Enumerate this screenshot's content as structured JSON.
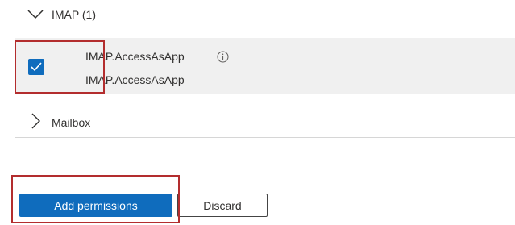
{
  "group": {
    "title": "IMAP (1)",
    "expanded": true,
    "chevron_icon": "chevron-down-icon"
  },
  "permission": {
    "name": "IMAP.AccessAsApp",
    "description": "IMAP.AccessAsApp",
    "checked": true,
    "info_icon": "info-icon"
  },
  "mailbox_group": {
    "title": "Mailbox",
    "expanded": false,
    "chevron_icon": "chevron-right-icon"
  },
  "actions": {
    "add_label": "Add permissions",
    "discard_label": "Discard"
  },
  "colors": {
    "accent": "#0f6cbd",
    "highlight": "#b32d2e",
    "row_selected_bg": "#f0f0f0"
  }
}
